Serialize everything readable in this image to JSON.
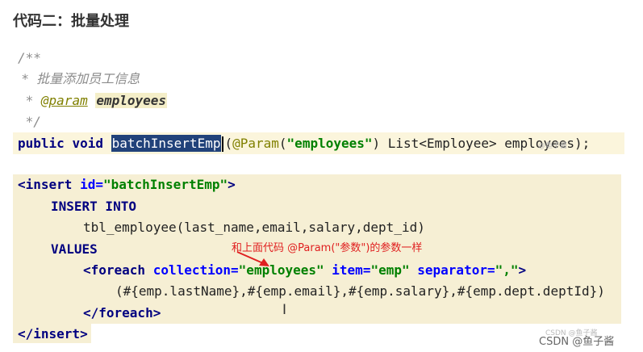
{
  "heading": "代码二：批量处理",
  "javadoc": {
    "open": "/**",
    "line1": " *  批量添加员工信息",
    "line2_prefix": " * ",
    "param_tag": "@param",
    "param_name": "employees",
    "close": " */"
  },
  "signature": {
    "public": "public",
    "void": "void",
    "method": "batchInsertEmp",
    "paren_open": "(",
    "annotation": "@Param",
    "annotation_arg": "\"employees\"",
    "rest": ") List<Employee> employees);"
  },
  "xml": {
    "insert_open_tag": "<insert",
    "id_attr": "id=",
    "id_value": "\"batchInsertEmp\"",
    "tag_close": ">",
    "sql_insert": "INSERT INTO",
    "table_cols": "tbl_employee(last_name,email,salary,dept_id)",
    "values_kw": "VALUES",
    "foreach_open": "<foreach",
    "collection_attr": "collection=",
    "collection_value": "\"employees\"",
    "item_attr": "item=",
    "item_value": "\"emp\"",
    "separator_attr": "separator=",
    "separator_value": "\",\"",
    "foreach_tag_close": ">",
    "values_expr": "(#{emp.lastName},#{emp.email},#{emp.salary},#{emp.dept.deptId})",
    "foreach_close": "</foreach>",
    "insert_close": "</insert>"
  },
  "annotation_note": "和上面代码 @Param(\"参数\")的参数一样",
  "watermark": "CSDN @鱼子酱",
  "watermark_faint": "CSDN @鱼子酱",
  "ghost_text": "@鱼子酱"
}
